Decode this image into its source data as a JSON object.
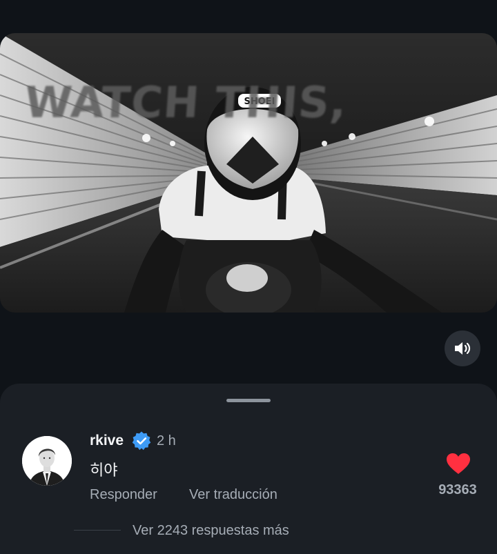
{
  "video": {
    "overlay_text": "WATCH THIS,"
  },
  "comment": {
    "username": "rkive",
    "verified": true,
    "timestamp": "2 h",
    "text": "히야",
    "reply_label": "Responder",
    "translate_label": "Ver traducción",
    "like_count": "93363",
    "liked": true,
    "view_replies_label": "Ver 2243 respuestas más"
  },
  "icons": {
    "sound": "speaker-volume-icon",
    "verified": "verified-badge-icon",
    "like": "heart-icon"
  },
  "colors": {
    "background": "#0f1318",
    "sheet": "#1b1f25",
    "verified_blue": "#3e9bf5",
    "heart_red": "#ff3040",
    "secondary_text": "#a6adb6"
  }
}
